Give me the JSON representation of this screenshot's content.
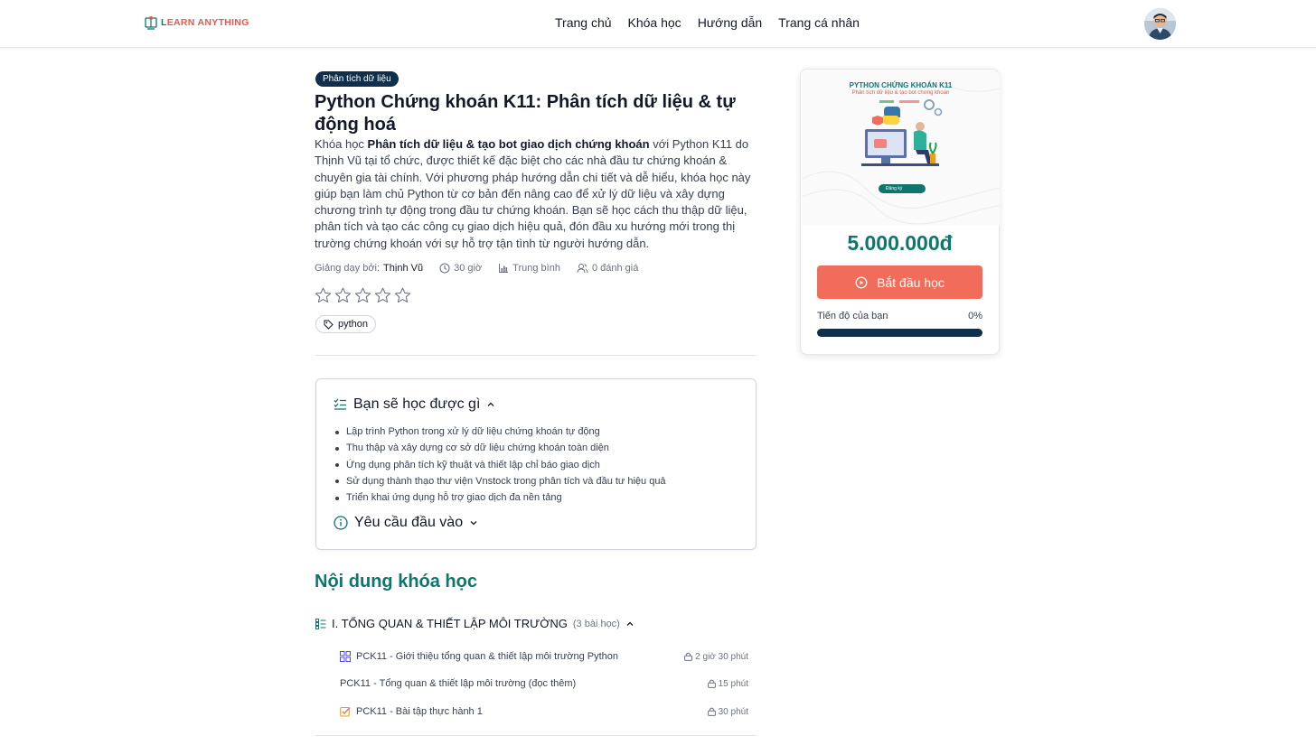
{
  "header": {
    "logo_text_first": "L",
    "logo_text_rest": "EARN ANYTHING",
    "nav": [
      "Trang chủ",
      "Khóa học",
      "Hướng dẫn",
      "Trang cá nhân"
    ]
  },
  "course": {
    "category": "Phân tích dữ liệu",
    "title": "Python Chứng khoán K11: Phân tích dữ liệu & tự động hoá",
    "description_prefix": "Khóa học ",
    "description_bold": "Phân tích dữ liệu & tạo bot giao dịch chứng khoán",
    "description_rest": " với Python K11 do Thịnh Vũ tại tổ chức, được thiết kế đặc biệt cho các nhà đầu tư chứng khoán & chuyên gia tài chính. Với phương pháp hướng dẫn chi tiết và dễ hiểu, khóa học này giúp bạn làm chủ Python từ cơ bản đến nâng cao để xử lý dữ liệu và xây dựng chương trình tự động trong đầu tư chứng khoán. Bạn sẽ học cách thu thập dữ liệu, phân tích và tạo các công cụ giao dịch hiệu quả, đón đầu xu hướng mới trong thị trường chứng khoán với sự hỗ trợ tận tình từ người hướng dẫn.",
    "meta": {
      "taught_by_label": "Giảng dạy bởi:",
      "teacher": "Thịnh Vũ",
      "duration": "30 giờ",
      "level": "Trung bình",
      "reviews": "0 đánh giá"
    },
    "rating": 0,
    "rating_max": 5,
    "tag": "python"
  },
  "learn": {
    "heading": "Bạn sẽ học được gì",
    "items": [
      "Lập trình Python trong xử lý dữ liệu chứng khoán tự động",
      "Thu thập và xây dựng cơ sở dữ liệu chứng khoán toàn diện",
      "Ứng dụng phân tích kỹ thuật và thiết lập chỉ báo giao dịch",
      "Sử dụng thành thạo thư viện Vnstock trong phân tích và đầu tư hiệu quả",
      "Triển khai ứng dụng hỗ trợ giao dịch đa nền tảng"
    ],
    "requirements_heading": "Yêu cầu đầu vào"
  },
  "content": {
    "heading": "Nội dung khóa học",
    "section": {
      "title": "I. TỔNG QUAN & THIẾT LẬP MÔI TRƯỜNG",
      "count": "(3 bài học)",
      "lessons": [
        {
          "name": "PCK11 - Giới thiệu tổng quan & thiết lập môi trường Python",
          "duration": "2 giờ 30 phút",
          "icon": "grid-icon"
        },
        {
          "name": "PCK11 - Tổng quan & thiết lập môi trường (đọc thêm)",
          "duration": "15 phút",
          "icon": ""
        },
        {
          "name": "PCK11 - Bài tập thực hành 1",
          "duration": "30 phút",
          "icon": "checkbox-icon"
        }
      ]
    }
  },
  "card": {
    "thumb_title": "PYTHON CHỨNG KHOÁN K11",
    "thumb_subtitle": "Phân tích dữ liệu & tạo bot chứng khoán",
    "thumb_button": "Đăng ký",
    "price": "5.000.000đ",
    "start_label": "Bắt đầu học",
    "progress_label": "Tiến độ của bạn",
    "progress_text": "0%",
    "progress_value": 0
  },
  "colors": {
    "brand_teal": "#0f766e",
    "accent_coral": "#f26c5c",
    "navy": "#0f2f4a"
  }
}
